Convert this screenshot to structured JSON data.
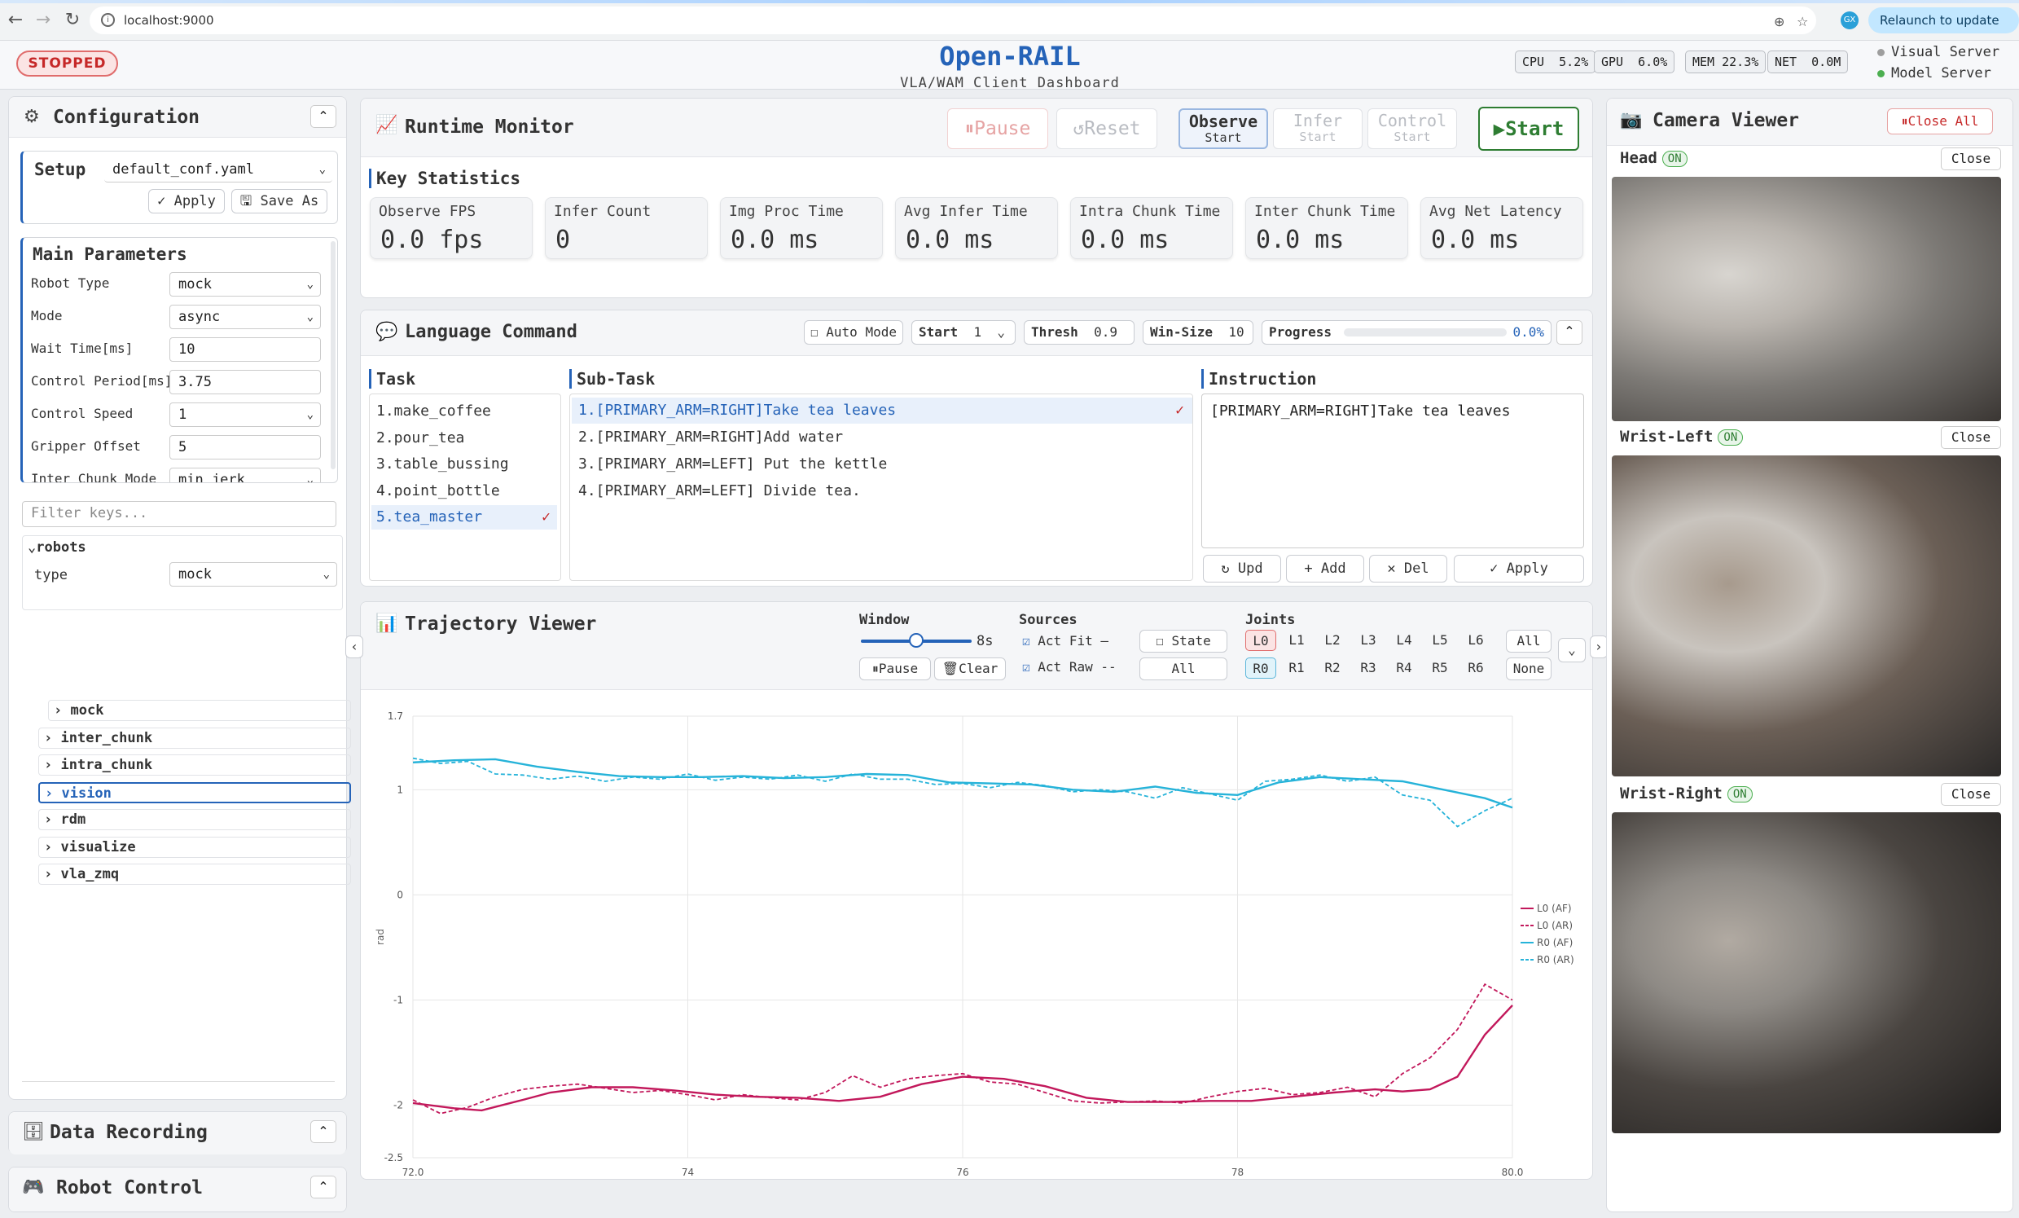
{
  "browser": {
    "url": "localhost:9000",
    "relaunch": "Relaunch to update",
    "profile": "GX"
  },
  "header": {
    "status": "STOPPED",
    "title": "Open-RAIL",
    "subtitle": "VLA/WAM Client Dashboard",
    "metrics": [
      {
        "label": "CPU",
        "value": "5.2%"
      },
      {
        "label": "GPU",
        "value": "6.0%"
      },
      {
        "label": "MEM",
        "value": "22.3%"
      },
      {
        "label": "NET",
        "value": "0.0M"
      }
    ],
    "servers": [
      {
        "name": "Visual Server",
        "color": "#9e9e9e"
      },
      {
        "name": "Model Server",
        "color": "#4caf50"
      }
    ]
  },
  "config": {
    "title": "Configuration",
    "setup_label": "Setup",
    "setup_file": "default_conf.yaml",
    "apply": "Apply",
    "save_as": "Save As",
    "main_params_title": "Main Parameters",
    "params": [
      {
        "label": "Robot Type",
        "value": "mock",
        "kind": "select"
      },
      {
        "label": "Mode",
        "value": "async",
        "kind": "select"
      },
      {
        "label": "Wait Time[ms]",
        "value": "10",
        "kind": "input"
      },
      {
        "label": "Control Period[ms]",
        "value": "3.75",
        "kind": "input"
      },
      {
        "label": "Control Speed",
        "value": "1",
        "kind": "select"
      },
      {
        "label": "Gripper Offset",
        "value": "5",
        "kind": "input"
      },
      {
        "label": "Inter Chunk Mode",
        "value": "min_jerk",
        "kind": "select"
      }
    ],
    "filter_placeholder": "Filter keys...",
    "tree_root": "robots",
    "tree_type_label": "type",
    "tree_type_value": "mock",
    "tree_items": [
      "mock",
      "inter_chunk",
      "intra_chunk",
      "vision",
      "rdm",
      "visualize",
      "vla_zmq"
    ]
  },
  "data_recording": {
    "title": "Data Recording"
  },
  "robot_control": {
    "title": "Robot Control"
  },
  "runtime": {
    "title": "Runtime Monitor",
    "pause": "Pause",
    "reset": "Reset",
    "modes": [
      {
        "label": "Observe",
        "sub": "Start"
      },
      {
        "label": "Infer",
        "sub": "Start"
      },
      {
        "label": "Control",
        "sub": "Start"
      }
    ],
    "start": "Start",
    "stats_title": "Key Statistics",
    "stats": [
      {
        "label": "Observe FPS",
        "value": "0.0 fps"
      },
      {
        "label": "Infer Count",
        "value": "0"
      },
      {
        "label": "Img Proc Time",
        "value": "0.0 ms"
      },
      {
        "label": "Avg Infer Time",
        "value": "0.0 ms"
      },
      {
        "label": "Intra Chunk Time",
        "value": "0.0 ms"
      },
      {
        "label": "Inter Chunk Time",
        "value": "0.0 ms"
      },
      {
        "label": "Avg Net Latency",
        "value": "0.0 ms"
      }
    ]
  },
  "language": {
    "title": "Language Command",
    "auto_mode": "Auto Mode",
    "start_label": "Start",
    "start_value": "1",
    "thresh_label": "Thresh",
    "thresh_value": "0.9",
    "winsize_label": "Win-Size",
    "winsize_value": "10",
    "progress_label": "Progress",
    "progress_value": "0.0%",
    "task_header": "Task",
    "subtask_header": "Sub-Task",
    "instruction_header": "Instruction",
    "tasks": [
      "1.make_coffee",
      "2.pour_tea",
      "3.table_bussing",
      "4.point_bottle",
      "5.tea_master"
    ],
    "subtasks": [
      "1.[PRIMARY_ARM=RIGHT]Take tea leaves",
      "2.[PRIMARY_ARM=RIGHT]Add water",
      "3.[PRIMARY_ARM=LEFT] Put the kettle",
      "4.[PRIMARY_ARM=LEFT] Divide tea."
    ],
    "instruction": "[PRIMARY_ARM=RIGHT]Take tea leaves",
    "upd": "Upd",
    "add": "Add",
    "del": "Del",
    "apply": "Apply"
  },
  "trajectory": {
    "title": "Trajectory Viewer",
    "window_label": "Window",
    "window_value": "8s",
    "window_fraction": 0.5,
    "pause": "Pause",
    "clear": "Clear",
    "sources_label": "Sources",
    "sources": [
      {
        "label": "Act Fit",
        "checked": true,
        "line": "—"
      },
      {
        "label": "Act Raw",
        "checked": true,
        "line": "--"
      },
      {
        "label": "State",
        "checked": false,
        "line": "····"
      }
    ],
    "sources_all": "All",
    "joints_label": "Joints",
    "left_joints": [
      "L0",
      "L1",
      "L2",
      "L3",
      "L4",
      "L5",
      "L6"
    ],
    "right_joints": [
      "R0",
      "R1",
      "R2",
      "R3",
      "R4",
      "R5",
      "R6"
    ],
    "joints_all": "All",
    "joints_none": "None"
  },
  "chart_data": {
    "type": "line",
    "xlim": [
      72.0,
      80.0
    ],
    "ylim": [
      -2.5,
      1.7
    ],
    "ylabel": "rad",
    "x_ticks": [
      "72.0",
      "74",
      "76",
      "78",
      "80.0"
    ],
    "y_ticks": [
      "1.7",
      "1",
      "0",
      "-1",
      "-2",
      "-2.5"
    ],
    "legend_position": "right",
    "series": [
      {
        "name": "L0 (AF)",
        "color": "#c2185b",
        "dash": false,
        "x": [
          72.0,
          72.3,
          72.5,
          72.8,
          73.0,
          73.3,
          73.6,
          73.9,
          74.2,
          74.5,
          74.8,
          75.1,
          75.4,
          75.7,
          76.0,
          76.3,
          76.6,
          76.9,
          77.2,
          77.5,
          77.8,
          78.1,
          78.4,
          78.7,
          79.0,
          79.2,
          79.4,
          79.6,
          79.8,
          80.0
        ],
        "y": [
          -1.98,
          -2.03,
          -2.05,
          -1.95,
          -1.88,
          -1.83,
          -1.83,
          -1.86,
          -1.9,
          -1.92,
          -1.93,
          -1.96,
          -1.92,
          -1.8,
          -1.73,
          -1.75,
          -1.82,
          -1.93,
          -1.97,
          -1.97,
          -1.96,
          -1.96,
          -1.92,
          -1.88,
          -1.85,
          -1.87,
          -1.85,
          -1.73,
          -1.33,
          -1.05
        ]
      },
      {
        "name": "L0 (AR)",
        "color": "#c2185b",
        "dash": true,
        "x": [
          72.0,
          72.2,
          72.4,
          72.6,
          72.8,
          73.0,
          73.2,
          73.4,
          73.6,
          73.8,
          74.0,
          74.2,
          74.4,
          74.6,
          74.8,
          75.0,
          75.2,
          75.4,
          75.6,
          75.8,
          76.0,
          76.2,
          76.4,
          76.6,
          76.8,
          77.0,
          77.2,
          77.4,
          77.6,
          77.8,
          78.0,
          78.2,
          78.4,
          78.6,
          78.8,
          79.0,
          79.2,
          79.4,
          79.6,
          79.8,
          80.0
        ],
        "y": [
          -1.95,
          -2.08,
          -2.02,
          -1.92,
          -1.85,
          -1.82,
          -1.8,
          -1.84,
          -1.88,
          -1.86,
          -1.9,
          -1.95,
          -1.9,
          -1.93,
          -1.95,
          -1.88,
          -1.72,
          -1.83,
          -1.75,
          -1.72,
          -1.7,
          -1.78,
          -1.8,
          -1.88,
          -1.96,
          -1.98,
          -1.97,
          -1.96,
          -1.98,
          -1.92,
          -1.87,
          -1.84,
          -1.9,
          -1.88,
          -1.83,
          -1.92,
          -1.7,
          -1.55,
          -1.28,
          -0.85,
          -1.0
        ]
      },
      {
        "name": "R0 (AF)",
        "color": "#26b3d9",
        "dash": false,
        "x": [
          72.0,
          72.3,
          72.6,
          72.9,
          73.2,
          73.5,
          73.8,
          74.1,
          74.4,
          74.7,
          75.0,
          75.3,
          75.6,
          75.9,
          76.2,
          76.5,
          76.8,
          77.1,
          77.4,
          77.7,
          78.0,
          78.3,
          78.6,
          78.9,
          79.2,
          79.5,
          79.8,
          80.0
        ],
        "y": [
          1.26,
          1.28,
          1.29,
          1.22,
          1.17,
          1.13,
          1.12,
          1.12,
          1.13,
          1.11,
          1.12,
          1.15,
          1.14,
          1.07,
          1.06,
          1.05,
          1.0,
          0.98,
          1.03,
          0.97,
          0.95,
          1.07,
          1.12,
          1.1,
          1.08,
          1.0,
          0.92,
          0.83
        ]
      },
      {
        "name": "R0 (AR)",
        "color": "#26b3d9",
        "dash": true,
        "x": [
          72.0,
          72.2,
          72.4,
          72.6,
          72.8,
          73.0,
          73.2,
          73.4,
          73.6,
          73.8,
          74.0,
          74.2,
          74.4,
          74.6,
          74.8,
          75.0,
          75.2,
          75.4,
          75.6,
          75.8,
          76.0,
          76.2,
          76.4,
          76.6,
          76.8,
          77.0,
          77.2,
          77.4,
          77.6,
          77.8,
          78.0,
          78.2,
          78.4,
          78.6,
          78.8,
          79.0,
          79.2,
          79.4,
          79.6,
          79.8,
          80.0
        ],
        "y": [
          1.3,
          1.25,
          1.27,
          1.15,
          1.14,
          1.1,
          1.13,
          1.08,
          1.12,
          1.1,
          1.15,
          1.09,
          1.12,
          1.1,
          1.14,
          1.08,
          1.15,
          1.1,
          1.1,
          1.05,
          1.06,
          1.02,
          1.07,
          1.04,
          0.98,
          1.0,
          0.98,
          0.92,
          1.02,
          0.96,
          0.9,
          1.08,
          1.1,
          1.14,
          1.08,
          1.12,
          0.95,
          0.9,
          0.65,
          0.8,
          0.92
        ]
      }
    ]
  },
  "camera": {
    "title": "Camera Viewer",
    "close_all": "Close All",
    "feeds": [
      {
        "name": "Head",
        "status": "ON",
        "close": "Close"
      },
      {
        "name": "Wrist-Left",
        "status": "ON",
        "close": "Close"
      },
      {
        "name": "Wrist-Right",
        "status": "ON",
        "close": "Close"
      }
    ]
  },
  "colors": {
    "accent": "#2563b8",
    "start_green": "#2e7d32",
    "stop_red": "#c62828",
    "af_red": "#c2185b",
    "af_cyan": "#26b3d9"
  }
}
